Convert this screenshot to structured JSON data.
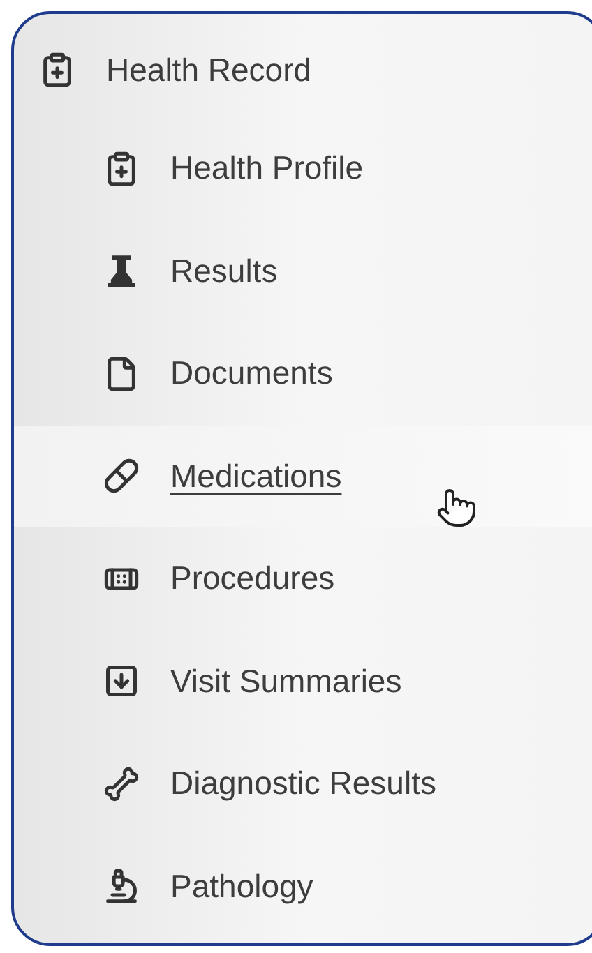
{
  "menu": {
    "title": "Health Record",
    "items": [
      {
        "label": "Health Profile",
        "hovered": false
      },
      {
        "label": "Results",
        "hovered": false
      },
      {
        "label": "Documents",
        "hovered": false
      },
      {
        "label": "Medications",
        "hovered": true
      },
      {
        "label": "Procedures",
        "hovered": false
      },
      {
        "label": "Visit Summaries",
        "hovered": false
      },
      {
        "label": "Diagnostic Results",
        "hovered": false
      },
      {
        "label": "Pathology",
        "hovered": false
      }
    ]
  }
}
